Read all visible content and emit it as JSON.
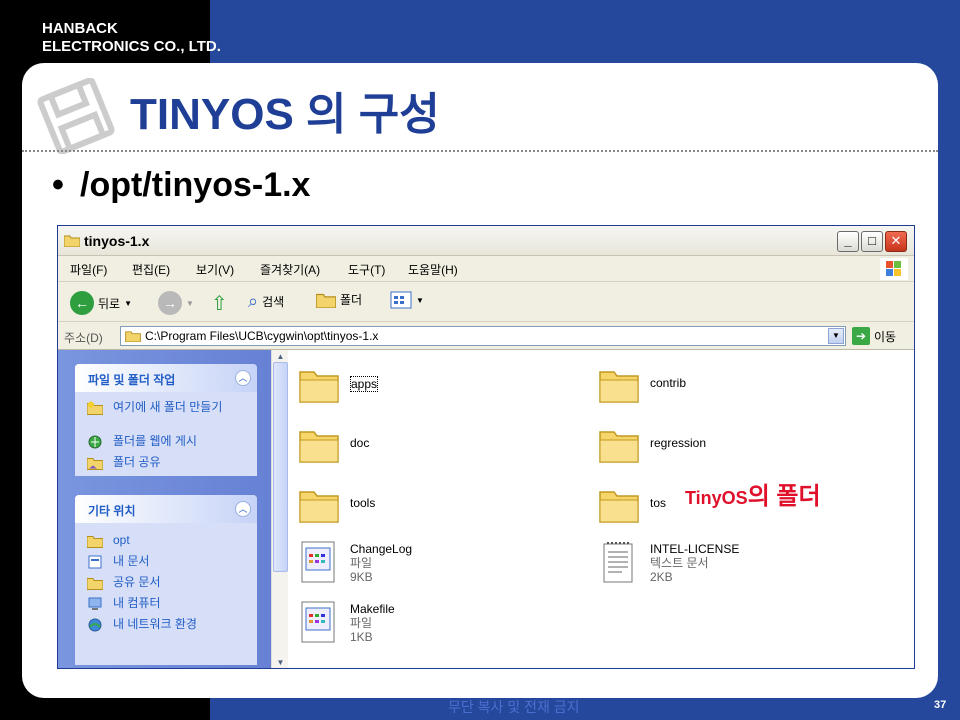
{
  "company": {
    "line1": "HANBACK",
    "line2": "ELECTRONICS CO., LTD."
  },
  "slide": {
    "title": "TINYOS 의 구성",
    "bullet": "/opt/tinyos-1.x",
    "annotation_a": "TinyOS",
    "annotation_b": "의 폴더",
    "footer": "무단 복사 및 전재 금지",
    "page": "37"
  },
  "window": {
    "title": "tinyos-1.x",
    "menu": [
      "파일(F)",
      "편집(E)",
      "보기(V)",
      "즐겨찾기(A)",
      "도구(T)",
      "도움말(H)"
    ],
    "toolbar": {
      "back": "뒤로",
      "search": "검색",
      "folders": "폴더"
    },
    "address": {
      "label": "주소(D)",
      "path": "C:\\Program Files\\UCB\\cygwin\\opt\\tinyos-1.x",
      "go": "이동"
    },
    "panels": [
      {
        "title": "파일 및 폴더 작업",
        "items": [
          {
            "label": "여기에 새 폴더 만들기",
            "icon": "new-folder-icon"
          },
          {
            "label": "폴더를 웹에 게시",
            "icon": "web-publish-icon"
          },
          {
            "label": "폴더 공유",
            "icon": "share-folder-icon"
          }
        ]
      },
      {
        "title": "기타 위치",
        "items": [
          {
            "label": "opt",
            "icon": "folder-icon"
          },
          {
            "label": "내 문서",
            "icon": "my-documents-icon"
          },
          {
            "label": "공유 문서",
            "icon": "shared-documents-icon"
          },
          {
            "label": "내 컴퓨터",
            "icon": "my-computer-icon"
          },
          {
            "label": "내 네트워크 환경",
            "icon": "network-icon"
          }
        ]
      }
    ],
    "files": [
      {
        "name": "apps",
        "type": "folder"
      },
      {
        "name": "contrib",
        "type": "folder"
      },
      {
        "name": "doc",
        "type": "folder"
      },
      {
        "name": "regression",
        "type": "folder"
      },
      {
        "name": "tools",
        "type": "folder"
      },
      {
        "name": "tos",
        "type": "folder"
      },
      {
        "name": "ChangeLog",
        "type": "file",
        "kind": "파일",
        "size": "9KB"
      },
      {
        "name": "INTEL-LICENSE",
        "type": "text",
        "kind": "텍스트 문서",
        "size": "2KB"
      },
      {
        "name": "Makefile",
        "type": "file",
        "kind": "파일",
        "size": "1KB"
      }
    ]
  }
}
